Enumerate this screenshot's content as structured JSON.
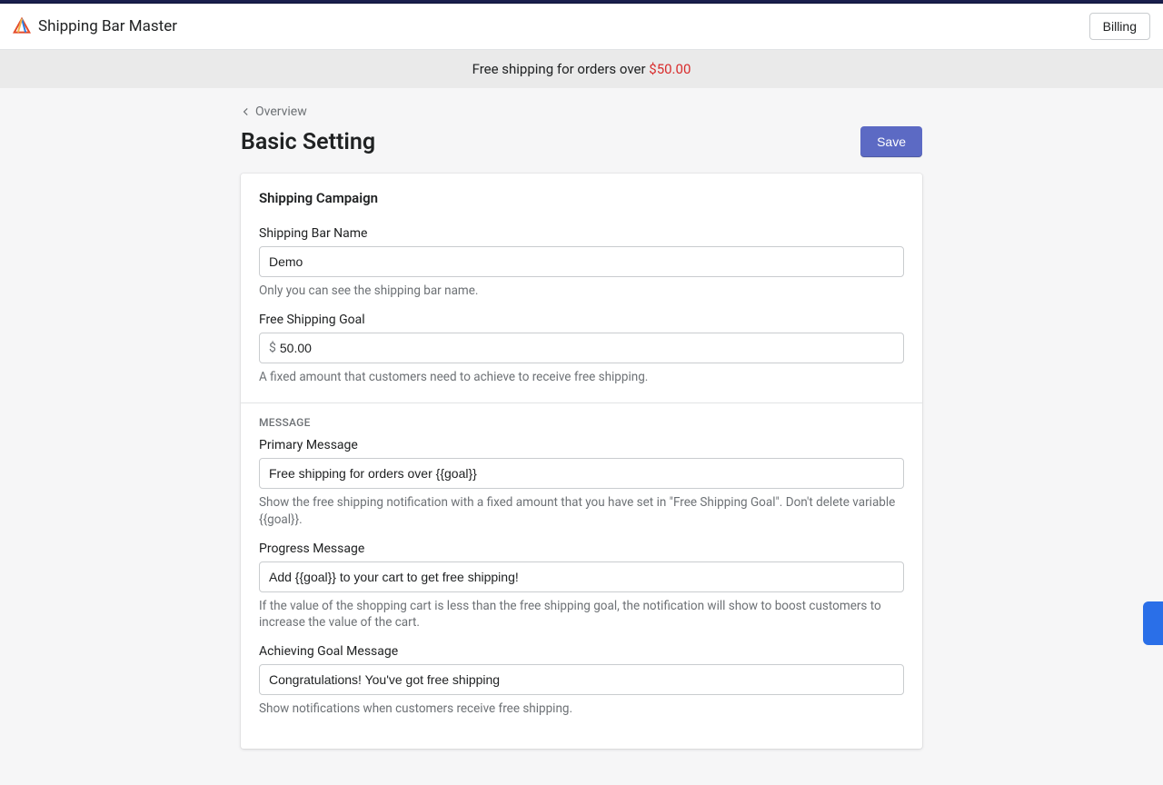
{
  "topbar": {
    "partial_text": "Shipping Bar Master"
  },
  "appbar": {
    "title": "Shipping Bar Master",
    "billing_label": "Billing"
  },
  "promo": {
    "prefix": "Free shipping for orders over ",
    "price": "$50.00"
  },
  "breadcrumb": {
    "label": "Overview"
  },
  "page": {
    "title": "Basic Setting",
    "save_label": "Save"
  },
  "card": {
    "title": "Shipping Campaign",
    "fields": {
      "name": {
        "label": "Shipping Bar Name",
        "value": "Demo",
        "help": "Only you can see the shipping bar name."
      },
      "goal": {
        "label": "Free Shipping Goal",
        "prefix": "$",
        "value": "50.00",
        "help": "A fixed amount that customers need to achieve to receive free shipping."
      }
    },
    "message_section_label": "MESSAGE",
    "messages": {
      "primary": {
        "label": "Primary Message",
        "value": "Free shipping for orders over {{goal}}",
        "help": "Show the free shipping notification with a fixed amount that you have set in \"Free Shipping Goal\". Don't delete variable {{goal}}."
      },
      "progress": {
        "label": "Progress Message",
        "value": "Add {{goal}} to your cart to get free shipping!",
        "help": "If the value of the shopping cart is less than the free shipping goal, the notification will show to boost customers to increase the value of the cart."
      },
      "achieving": {
        "label": "Achieving Goal Message",
        "value": "Congratulations! You've got free shipping",
        "help": "Show notifications when customers receive free shipping."
      }
    }
  }
}
